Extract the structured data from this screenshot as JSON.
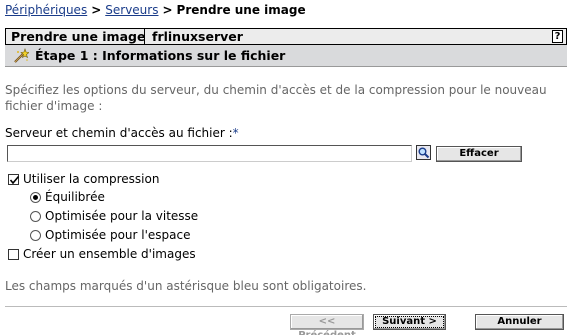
{
  "breadcrumb": {
    "items": [
      {
        "label": "Périphériques"
      },
      {
        "label": "Serveurs"
      }
    ],
    "current": "Prendre une image",
    "separator": ">"
  },
  "title_bar": {
    "title": "Prendre une image",
    "server": "frlinuxserver",
    "help": "?"
  },
  "step": {
    "icon": "wand-icon",
    "label": "Étape 1 : Informations sur le fichier"
  },
  "description": "Spécifiez les options du serveur, du chemin d'accès et de la compression pour le nouveau fichier d'image :",
  "path_field": {
    "label": "Serveur et chemin d'accès au fichier :",
    "required_mark": "*",
    "value": "",
    "browse_icon": "browse-search-icon",
    "clear_label": "Effacer"
  },
  "compression": {
    "label": "Utiliser la compression",
    "checked": true,
    "options": [
      {
        "label": "Équilibrée",
        "selected": true
      },
      {
        "label": "Optimisée pour la vitesse",
        "selected": false
      },
      {
        "label": "Optimisée pour l'espace",
        "selected": false
      }
    ]
  },
  "image_set": {
    "label": "Créer un ensemble d'images",
    "checked": false
  },
  "footnote": "Les champs marqués d'un astérisque bleu sont obligatoires.",
  "buttons": {
    "previous": "<< Précédent",
    "next": "Suivant >",
    "cancel": "Annuler"
  },
  "colors": {
    "link": "#1a3c8a",
    "step_bar": "#d9dadc",
    "title_bar": "#ececec",
    "muted_text": "#666666"
  }
}
